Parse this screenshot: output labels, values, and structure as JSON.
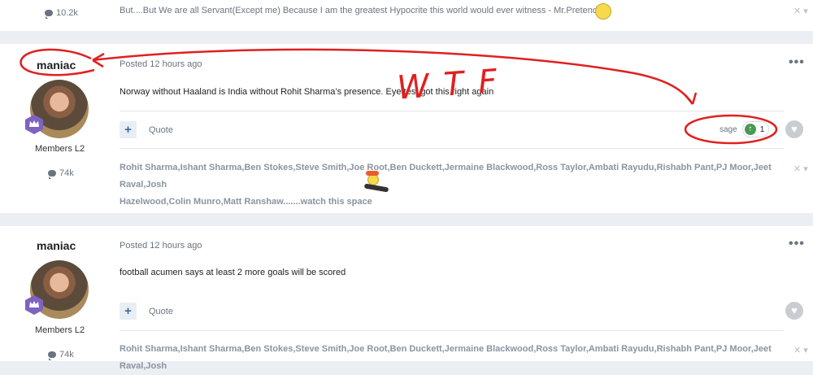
{
  "top_post": {
    "stat": "10.2k",
    "signature": "But....But We are all Servant(Except me) Because I am the greatest Hypocrite this world would ever witness - Mr.Pretendor"
  },
  "posts": [
    {
      "author": "maniac",
      "group": "Members L2",
      "stat": "74k",
      "posted": "Posted 12 hours ago",
      "content": "Norway without Haaland is India without Rohit Sharma’s presence. Eye test got this right again",
      "quote_label": "Quote",
      "reputation": {
        "user": "sage",
        "count": "1"
      },
      "signature_line1": "Rohit Sharma,Ishant Sharma,Ben Stokes,Steve Smith,Joe Root,Ben Duckett,Jermaine Blackwood,Ross Taylor,Ambati Rayudu,Rishabh Pant,PJ Moor,Jeet Raval,Josh",
      "signature_line2": "Hazelwood,Colin Munro,Matt Ranshaw.......watch this space"
    },
    {
      "author": "maniac",
      "group": "Members L2",
      "stat": "74k",
      "posted": "Posted 12 hours ago",
      "content": "football acumen says at least 2 more goals will be scored",
      "quote_label": "Quote",
      "signature_line1": "Rohit Sharma,Ishant Sharma,Ben Stokes,Steve Smith,Joe Root,Ben Duckett,Jermaine Blackwood,Ross Taylor,Ambati Rayudu,Rishabh Pant,PJ Moor,Jeet Raval,Josh"
    }
  ],
  "annotation": {
    "text": "WTF",
    "color": "#e02020"
  },
  "icons": {
    "stat": "speech-bubble-icon",
    "badge": "crown-icon",
    "more": "ellipsis-icon",
    "add": "plus-icon",
    "like": "heart-icon",
    "upvote": "arrow-up-icon",
    "close": "close-icon"
  },
  "colors": {
    "page_bg": "#ebeef2",
    "badge": "#7e62c0",
    "upvote": "#4a9a52",
    "link_blue": "#3b6aa0"
  }
}
